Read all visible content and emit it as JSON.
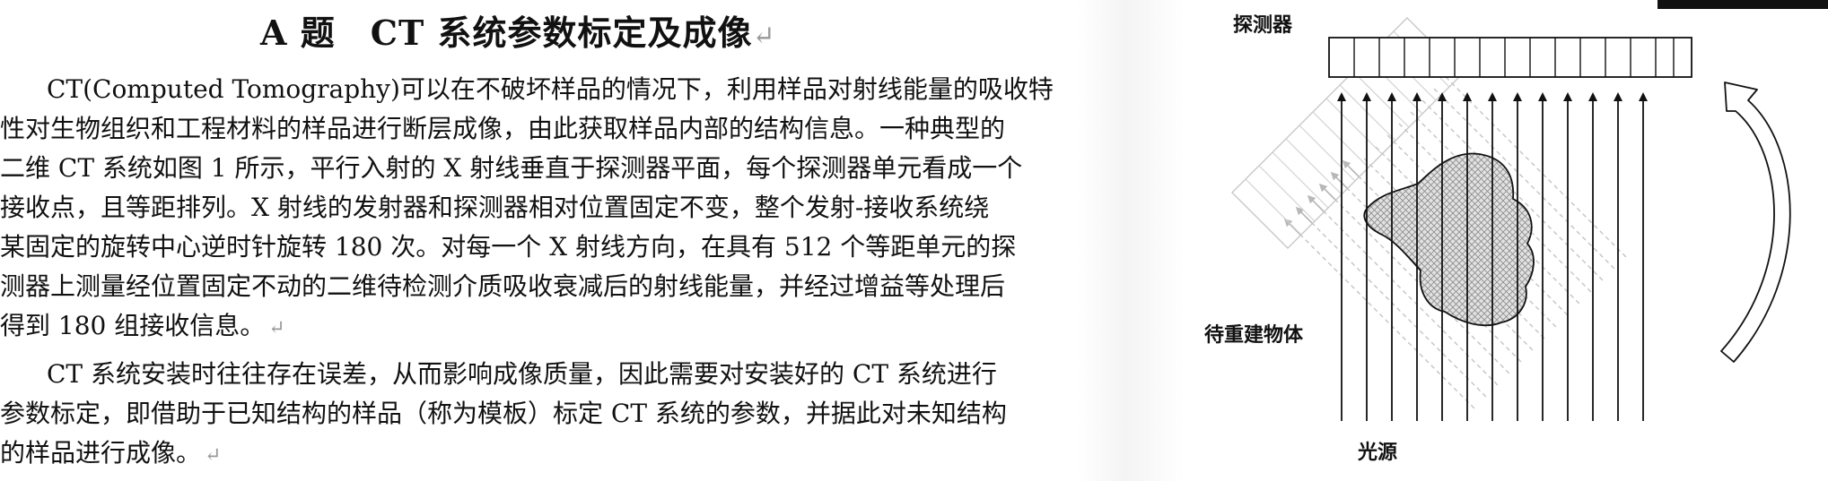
{
  "document": {
    "title": "A 题　CT 系统参数标定及成像",
    "paragraph_mark": "↵",
    "lines": [
      "CT(Computed Tomography)可以在不破坏样品的情况下，利用样品对射线能量的吸收特",
      "性对生物组织和工程材料的样品进行断层成像，由此获取样品内部的结构信息。一种典型的",
      "二维 CT 系统如图 1 所示，平行入射的 X 射线垂直于探测器平面，每个探测器单元看成一个",
      "接收点，且等距排列。X 射线的发射器和探测器相对位置固定不变，整个发射-接收系统绕",
      "某固定的旋转中心逆时针旋转 180 次。对每一个 X 射线方向，在具有 512 个等距单元的探",
      "测器上测量经位置固定不动的二维待检测介质吸收衰减后的射线能量，并经过增益等处理后",
      "得到 180 组接收信息。",
      "CT 系统安装时往往存在误差，从而影响成像质量，因此需要对安装好的 CT 系统进行",
      "参数标定，即借助于已知结构的样品（称为模板）标定 CT 系统的参数，并据此对未知结构",
      "的样品进行成像。"
    ]
  },
  "figure": {
    "detector_label": "探测器",
    "object_label": "待重建物体",
    "source_label": "光源"
  }
}
